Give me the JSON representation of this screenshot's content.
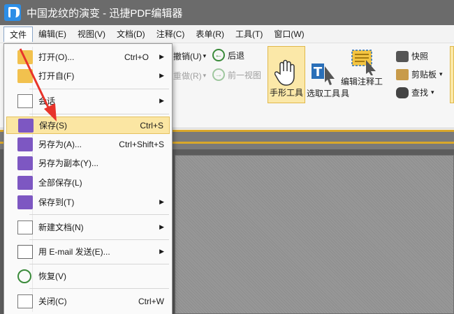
{
  "window": {
    "title": "中国龙纹的演变 - 迅捷PDF编辑器"
  },
  "menubar": [
    {
      "label": "文件",
      "active": true
    },
    {
      "label": "编辑(E)"
    },
    {
      "label": "视图(V)"
    },
    {
      "label": "文档(D)"
    },
    {
      "label": "注释(C)"
    },
    {
      "label": "表单(R)"
    },
    {
      "label": "工具(T)"
    },
    {
      "label": "窗口(W)"
    }
  ],
  "ribbon": {
    "undo": "撤销(U)",
    "redo": "重做(R)",
    "back": "后退",
    "forward": "前一视图",
    "hand_tool": "手形工具",
    "select_tool": "选取工具",
    "edit_annot_tool": "编辑注释工具",
    "snapshot": "快照",
    "clipboard": "剪贴板",
    "find": "查找",
    "dropdown_arrow": "▾"
  },
  "file_menu": {
    "items": [
      {
        "label": "打开(O)...",
        "shortcut": "Ctrl+O",
        "submenu": true,
        "icon": "folder-open-icon"
      },
      {
        "label": "打开自(F)",
        "shortcut": "",
        "submenu": true,
        "icon": "open-from-icon"
      },
      {
        "label": "会话",
        "shortcut": "",
        "submenu": true,
        "icon": "session-icon"
      },
      {
        "label": "保存(S)",
        "shortcut": "Ctrl+S",
        "submenu": false,
        "icon": "save-icon",
        "highlight": true
      },
      {
        "label": "另存为(A)...",
        "shortcut": "Ctrl+Shift+S",
        "submenu": false,
        "icon": "save-as-icon"
      },
      {
        "label": "另存为副本(Y)...",
        "shortcut": "",
        "submenu": false,
        "icon": "save-copy-icon"
      },
      {
        "label": "全部保存(L)",
        "shortcut": "",
        "submenu": false,
        "icon": "save-all-icon"
      },
      {
        "label": "保存到(T)",
        "shortcut": "",
        "submenu": true,
        "icon": "save-to-icon"
      },
      {
        "label": "新建文档(N)",
        "shortcut": "",
        "submenu": true,
        "icon": "new-document-icon"
      },
      {
        "label": "用 E-mail 发送(E)...",
        "shortcut": "",
        "submenu": true,
        "icon": "email-icon"
      },
      {
        "label": "恢复(V)",
        "shortcut": "",
        "submenu": false,
        "icon": "revert-icon"
      },
      {
        "label": "关闭(C)",
        "shortcut": "Ctrl+W",
        "submenu": false,
        "icon": "close-doc-icon"
      }
    ],
    "submenu_arrow": "▶"
  },
  "colors": {
    "titlebar": "#6b6b6b",
    "highlight": "#fbe6a3",
    "accent_gold": "#d9a72a",
    "annotation_arrow": "#e8342b"
  }
}
